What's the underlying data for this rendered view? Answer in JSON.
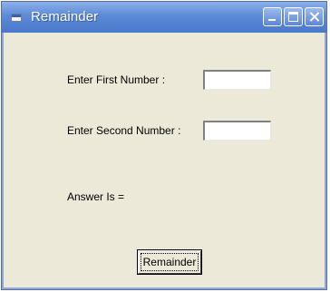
{
  "window": {
    "title": "Remainder"
  },
  "form": {
    "first_label": "Enter First Number :",
    "first_value": "",
    "second_label": "Enter Second Number :",
    "second_value": "",
    "answer_label": "Answer Is ="
  },
  "actions": {
    "remainder_button": "Remainder"
  },
  "icons": {
    "app": "form-window-icon",
    "minimize": "minimize-icon",
    "maximize": "maximize-icon",
    "close": "close-icon"
  },
  "colors": {
    "titlebar": "#4a78cc",
    "window_face": "#ece9d8"
  }
}
